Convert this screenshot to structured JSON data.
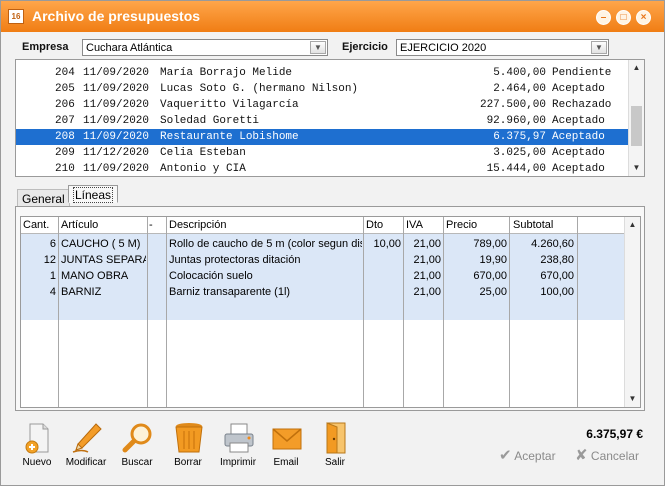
{
  "window": {
    "title": "Archivo de presupuestos"
  },
  "filters": {
    "empresa_label": "Empresa",
    "empresa_value": "Cuchara Atlántica",
    "ejercicio_label": "Ejercicio",
    "ejercicio_value": "EJERCICIO 2020"
  },
  "budgets": [
    {
      "num": "204",
      "date": "11/09/2020",
      "client": "María Borrajo Melide",
      "amount": "5.400,00",
      "status": "Pendiente"
    },
    {
      "num": "205",
      "date": "11/09/2020",
      "client": "Lucas Soto G. (hermano Nilson)",
      "amount": "2.464,00",
      "status": "Aceptado"
    },
    {
      "num": "206",
      "date": "11/09/2020",
      "client": "Vaqueritto Vilagarcía",
      "amount": "227.500,00",
      "status": "Rechazado"
    },
    {
      "num": "207",
      "date": "11/09/2020",
      "client": "Soledad Goretti",
      "amount": "92.960,00",
      "status": "Aceptado"
    },
    {
      "num": "208",
      "date": "11/09/2020",
      "client": "Restaurante Lobishome",
      "amount": "6.375,97",
      "status": "Aceptado",
      "selected": true
    },
    {
      "num": "209",
      "date": "11/12/2020",
      "client": "Celia Esteban",
      "amount": "3.025,00",
      "status": "Aceptado"
    },
    {
      "num": "210",
      "date": "11/09/2020",
      "client": "Antonio y CIA",
      "amount": "15.444,00",
      "status": "Aceptado"
    }
  ],
  "tabs": [
    {
      "label": "General",
      "active": false
    },
    {
      "label": "Líneas",
      "active": true
    }
  ],
  "lines": {
    "headers": [
      "Cant.",
      "Artículo",
      "-",
      "Descripción",
      "Dto",
      "IVA",
      "Precio",
      "Subtotal"
    ],
    "rows": [
      {
        "cant": "6",
        "articulo": "CAUCHO ( 5 M)",
        "descripcion": "Rollo de caucho de 5 m (color segun dis",
        "dto": "10,00",
        "iva": "21,00",
        "precio": "789,00",
        "subtotal": "4.260,60"
      },
      {
        "cant": "12",
        "articulo": "JUNTAS SEPARA",
        "descripcion": "Juntas protectoras ditación",
        "dto": "",
        "iva": "21,00",
        "precio": "19,90",
        "subtotal": "238,80"
      },
      {
        "cant": "1",
        "articulo": "MANO OBRA",
        "descripcion": "Colocación suelo",
        "dto": "",
        "iva": "21,00",
        "precio": "670,00",
        "subtotal": "670,00"
      },
      {
        "cant": "4",
        "articulo": "BARNIZ",
        "descripcion": "Barniz transaparente (1l)",
        "dto": "",
        "iva": "21,00",
        "precio": "25,00",
        "subtotal": "100,00"
      }
    ]
  },
  "toolbar": [
    {
      "label": "Nuevo",
      "icon": "new-document-icon"
    },
    {
      "label": "Modificar",
      "icon": "pencil-icon"
    },
    {
      "label": "Buscar",
      "icon": "magnifier-icon"
    },
    {
      "label": "Borrar",
      "icon": "trash-bin-icon"
    },
    {
      "label": "Imprimir",
      "icon": "printer-icon"
    },
    {
      "label": "Email",
      "icon": "envelope-icon"
    },
    {
      "label": "Salir",
      "icon": "exit-door-icon"
    }
  ],
  "total": "6.375,97 €",
  "actions": {
    "accept": "Aceptar",
    "cancel": "Cancelar"
  },
  "colors": {
    "titlebar": "#f07d14",
    "selection": "#1e6fd0",
    "grid_fill": "#dbe7f7"
  }
}
